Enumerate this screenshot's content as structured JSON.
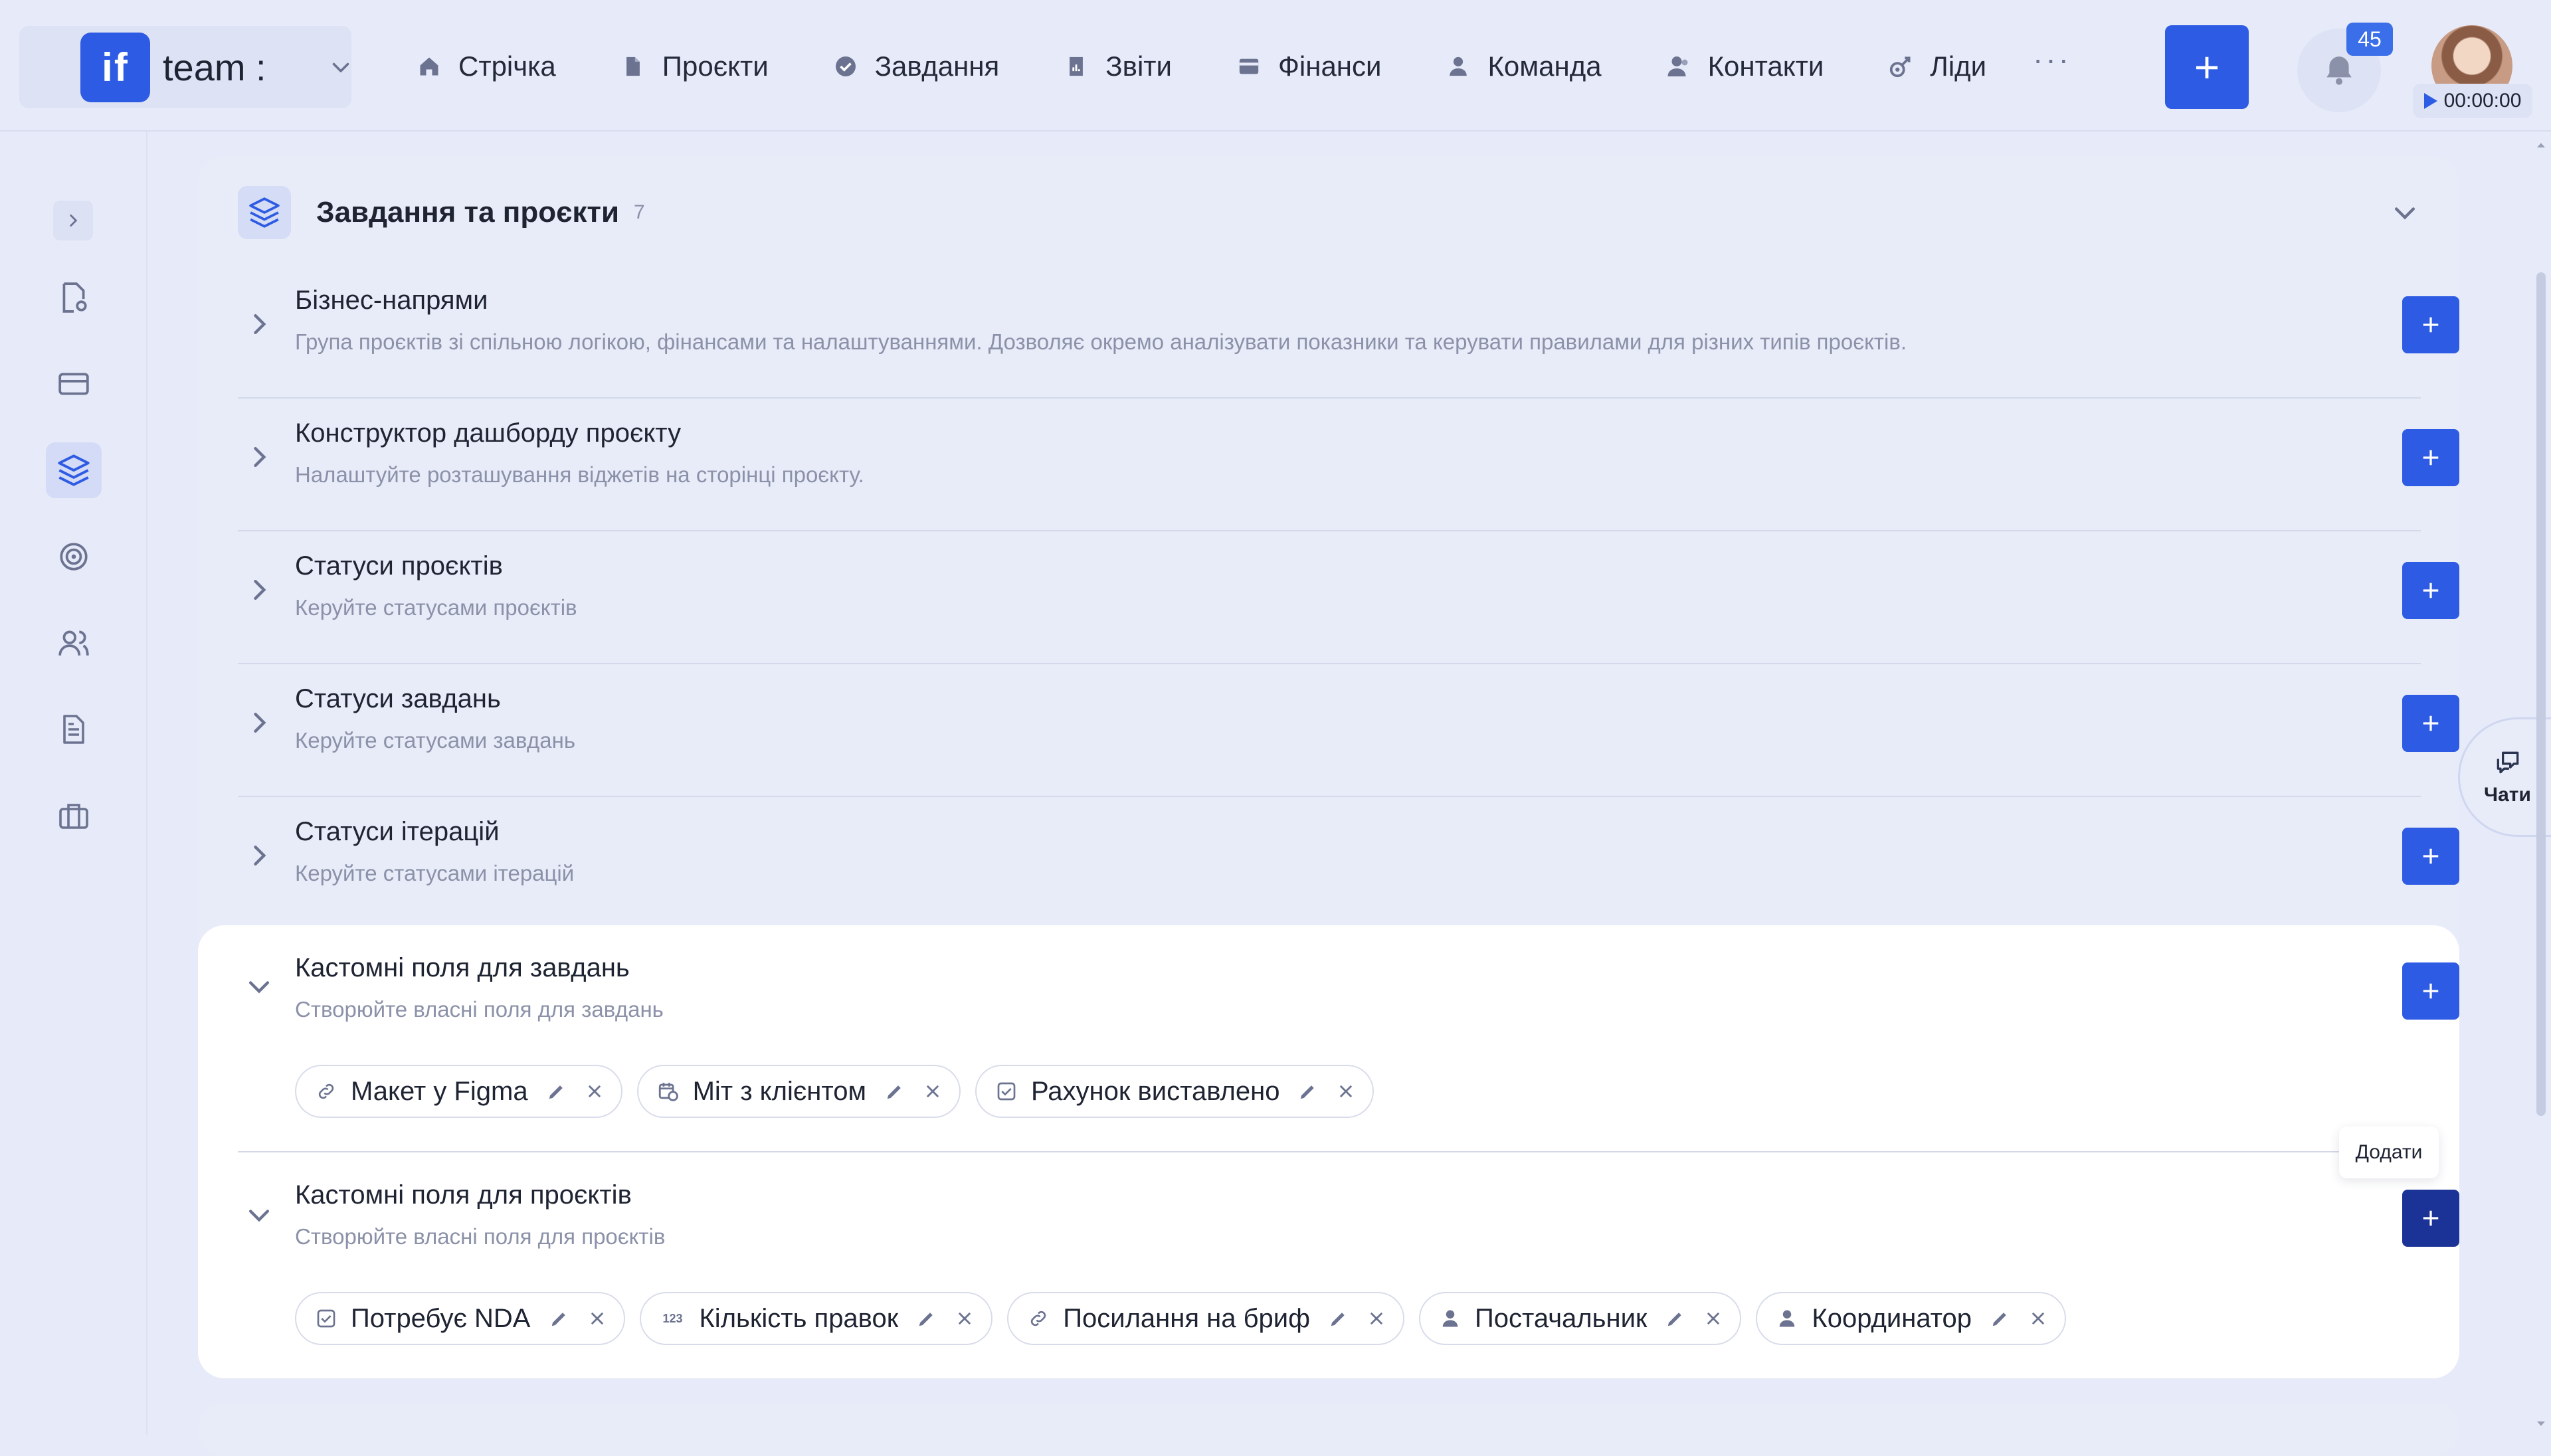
{
  "workspace": {
    "logo_text": "if",
    "name": "team :"
  },
  "nav": [
    {
      "label": "Стрічка",
      "icon": "home-icon"
    },
    {
      "label": "Проєкти",
      "icon": "document-icon"
    },
    {
      "label": "Завдання",
      "icon": "check-circle-icon"
    },
    {
      "label": "Звіти",
      "icon": "report-icon"
    },
    {
      "label": "Фінанси",
      "icon": "wallet-icon"
    },
    {
      "label": "Команда",
      "icon": "user-icon"
    },
    {
      "label": "Контакти",
      "icon": "contacts-icon"
    },
    {
      "label": "Ліди",
      "icon": "leads-icon"
    }
  ],
  "topbar": {
    "more": "···",
    "add_label": "+",
    "notifications_count": "45",
    "timer": "00:00:00"
  },
  "panel": {
    "title": "Завдання та проєкти",
    "count": "7"
  },
  "sections": [
    {
      "title": "Бізнес-напрями",
      "desc": "Група проєктів зі спільною логікою, фінансами та налаштуваннями. Дозволяє окремо аналізувати показники та керувати правилами для різних типів проєктів."
    },
    {
      "title": "Конструктор дашборду проєкту",
      "desc": "Налаштуйте розташування віджетів на сторінці проєкту."
    },
    {
      "title": "Статуси проєктів",
      "desc": "Керуйте статусами проєктів"
    },
    {
      "title": "Статуси завдань",
      "desc": "Керуйте статусами завдань"
    },
    {
      "title": "Статуси ітерацій",
      "desc": "Керуйте статусами ітерацій"
    },
    {
      "title": "Кастомні поля для завдань",
      "desc": "Створюйте власні поля для завдань"
    },
    {
      "title": "Кастомні поля для проєктів",
      "desc": "Створюйте власні поля для проєктів"
    }
  ],
  "task_fields": [
    {
      "label": "Макет у Figma",
      "icon": "link-icon"
    },
    {
      "label": "Міт з клієнтом",
      "icon": "calendar-clock-icon"
    },
    {
      "label": "Рахунок виставлено",
      "icon": "checkbox-icon"
    }
  ],
  "project_fields": [
    {
      "label": "Потребує NDA",
      "icon": "checkbox-icon"
    },
    {
      "label": "Кількість правок",
      "icon": "number-icon"
    },
    {
      "label": "Посилання на бриф",
      "icon": "link-icon"
    },
    {
      "label": "Постачальник",
      "icon": "user-icon"
    },
    {
      "label": "Координатор",
      "icon": "user-icon"
    }
  ],
  "tooltip": "Додати",
  "chat": {
    "label": "Чати"
  },
  "number_icon_text": "123",
  "colors": {
    "accent": "#2d5be3",
    "accent_dark": "#1b3396",
    "background": "#e7ebf9",
    "muted_text": "#8b91a8"
  }
}
